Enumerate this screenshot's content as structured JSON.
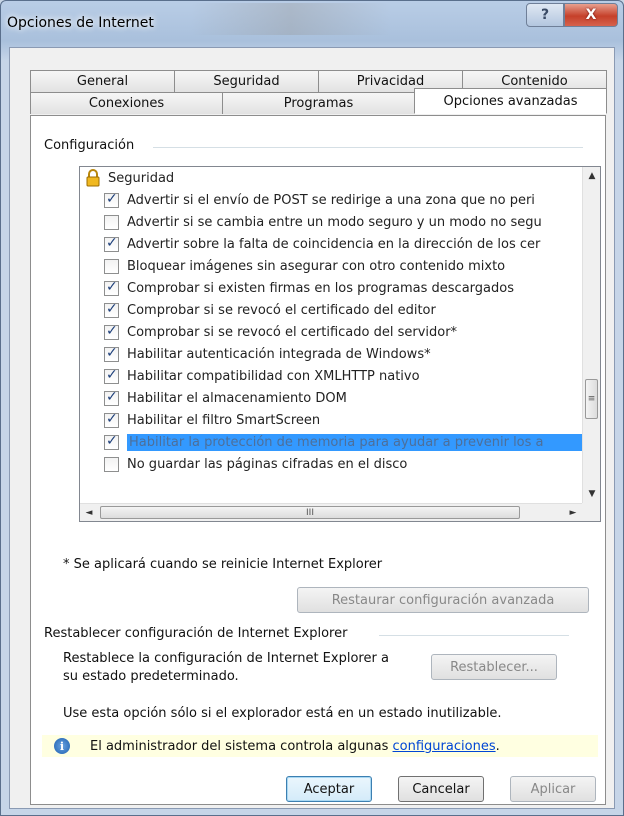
{
  "window": {
    "title": "Opciones de Internet",
    "help_glyph": "?",
    "close_glyph": "X"
  },
  "tabs": {
    "back": [
      "General",
      "Seguridad",
      "Privacidad",
      "Contenido"
    ],
    "front": [
      "Conexiones",
      "Programas",
      "Opciones avanzadas"
    ],
    "active": "Opciones avanzadas"
  },
  "settings": {
    "group_label": "Configuración",
    "category": {
      "label": "Seguridad",
      "icon": "lock-icon"
    },
    "items": [
      {
        "label": "Advertir si el envío de POST se redirige a una zona que no peri",
        "checked": true
      },
      {
        "label": "Advertir si se cambia entre un modo seguro y un modo no segu",
        "checked": false
      },
      {
        "label": "Advertir sobre la falta de coincidencia en la dirección de los cer",
        "checked": true
      },
      {
        "label": "Bloquear imágenes sin asegurar con otro contenido mixto",
        "checked": false
      },
      {
        "label": "Comprobar si existen firmas en los programas descargados",
        "checked": true
      },
      {
        "label": "Comprobar si se revocó el certificado del editor",
        "checked": true
      },
      {
        "label": "Comprobar si se revocó el certificado del servidor*",
        "checked": true
      },
      {
        "label": "Habilitar autenticación integrada de Windows*",
        "checked": true
      },
      {
        "label": "Habilitar compatibilidad con XMLHTTP nativo",
        "checked": true
      },
      {
        "label": "Habilitar el almacenamiento DOM",
        "checked": true
      },
      {
        "label": "Habilitar el filtro SmartScreen",
        "checked": true
      },
      {
        "label": "Habilitar la protección de memoria para ayudar a prevenir los a",
        "checked": true,
        "selected": true
      },
      {
        "label": "No guardar las páginas cifradas en el disco",
        "checked": false
      }
    ],
    "scroll_glyphs": {
      "up": "▲",
      "down": "▼",
      "left": "◄",
      "right": "►",
      "vgrip": "≡",
      "hgrip": "III"
    },
    "restart_note": "* Se aplicará cuando se reinicie Internet Explorer",
    "restore_button": "Restaurar configuración avanzada"
  },
  "reset": {
    "group_label": "Restablecer configuración de Internet Explorer",
    "description_line1": "Restablece la configuración de Internet Explorer a",
    "description_line2": "su estado predeterminado.",
    "reset_button": "Restablecer...",
    "note": "Use esta opción sólo si el explorador está en un estado inutilizable."
  },
  "infobar": {
    "text": "El administrador del sistema controla algunas ",
    "link": "configuraciones",
    "suffix": "."
  },
  "footer": {
    "ok": "Aceptar",
    "cancel": "Cancelar",
    "apply": "Aplicar"
  }
}
